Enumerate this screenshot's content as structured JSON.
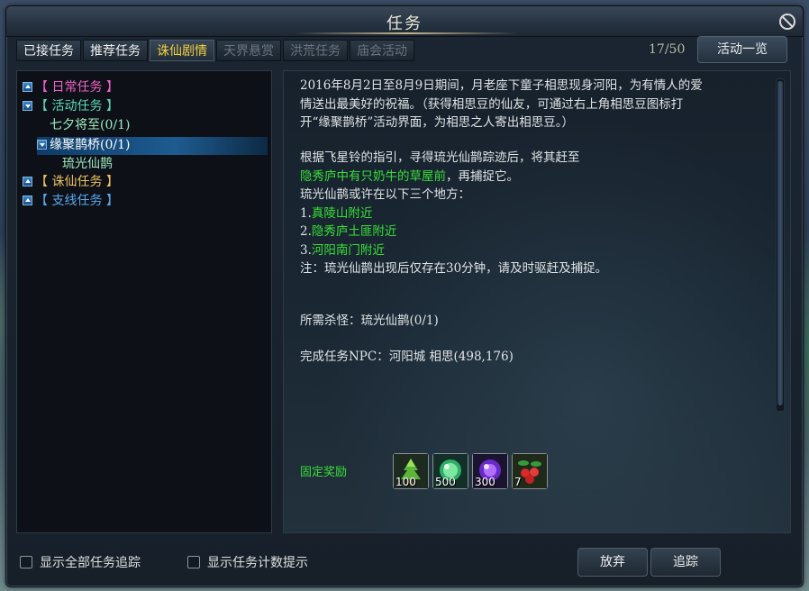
{
  "window": {
    "title": "任务"
  },
  "tabs": [
    {
      "label": "已接任务",
      "state": "enabled"
    },
    {
      "label": "推荐任务",
      "state": "enabled"
    },
    {
      "label": "诛仙剧情",
      "state": "active"
    },
    {
      "label": "天界悬赏",
      "state": "disabled"
    },
    {
      "label": "洪荒任务",
      "state": "disabled"
    },
    {
      "label": "庙会活动",
      "state": "disabled"
    }
  ],
  "quest_counter": "17/50",
  "overview_button": "活动一览",
  "tree": {
    "daily": "【 日常任务 】",
    "activity": "【 活动任务 】",
    "activity_child_1": "七夕将至(0/1)",
    "activity_child_2": "缘聚鹊桥(0/1)",
    "activity_child_2_leaf": "琉光仙鹊",
    "zhuxian": "【 诛仙任务 】",
    "branch": "【 支线任务 】"
  },
  "detail": {
    "intro_line1": "2016年8月2日至8月9日期间，月老座下童子相思现身河阳，为有情人的爱",
    "intro_line2": "情送出最美好的祝福。（获得相思豆的仙友，可通过右上角相思豆图标打",
    "intro_line3": "开“缘聚鹊桥”活动界面，为相思之人寄出相思豆。）",
    "guide_line1": "根据飞星铃的指引，寻得琉光仙鹊踪迹后，将其赶至",
    "guide_highlight": "隐秀庐中有只奶牛的草屋前",
    "guide_line2_tail": "，再捕捉它。",
    "locations_header": "琉光仙鹊或许在以下三个地方：",
    "loc1_num": "1.",
    "loc1": "真陵山附近",
    "loc2_num": "2.",
    "loc2": "隐秀庐土匪附近",
    "loc3_num": "3.",
    "loc3": "河阳南门附近",
    "note": "注：琉光仙鹊出现后仅存在30分钟，请及时驱赶及捕捉。",
    "kill_req": "所需杀怪：琉光仙鹊(0/1)",
    "complete_npc": "完成任务NPC：河阳城 相思(498,176)"
  },
  "rewards": {
    "label": "固定奖励",
    "items": [
      {
        "icon": "tree-icon",
        "count": "100"
      },
      {
        "icon": "jade-orb-icon",
        "count": "500"
      },
      {
        "icon": "purple-orb-icon",
        "count": "300"
      },
      {
        "icon": "red-berries-icon",
        "count": "7"
      }
    ]
  },
  "bottom": {
    "show_all_tracking": "显示全部任务追踪",
    "show_count_tip": "显示任务计数提示",
    "abandon": "放弃",
    "track": "追踪"
  }
}
